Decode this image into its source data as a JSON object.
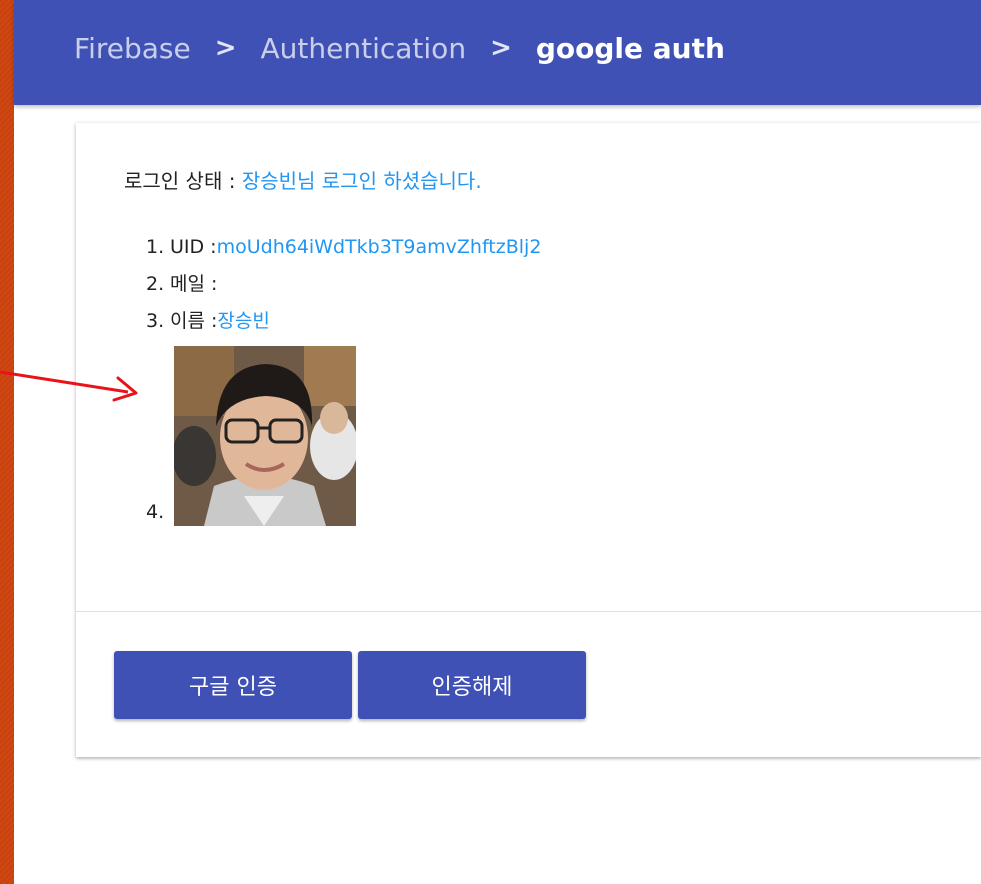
{
  "breadcrumb": {
    "items": [
      "Firebase",
      "Authentication"
    ],
    "current": "google auth",
    "separator": ">"
  },
  "status": {
    "label": "로그인 상태 : ",
    "value": "장승빈님 로그인 하셨습니다."
  },
  "info": [
    {
      "num": "1.",
      "label": "UID : ",
      "value": "moUdh64iWdTkb3T9amvZhftzBlj2"
    },
    {
      "num": "2.",
      "label": "메일 : ",
      "value": ""
    },
    {
      "num": "3.",
      "label": "이름 : ",
      "value": "장승빈"
    },
    {
      "num": "4.",
      "label": "",
      "value": ""
    }
  ],
  "buttons": {
    "google_auth": "구글 인증",
    "sign_out": "인증해제"
  },
  "colors": {
    "primary": "#3f51b5",
    "link": "#2196f3",
    "background": "#c8410f",
    "arrow": "#e8141a"
  }
}
